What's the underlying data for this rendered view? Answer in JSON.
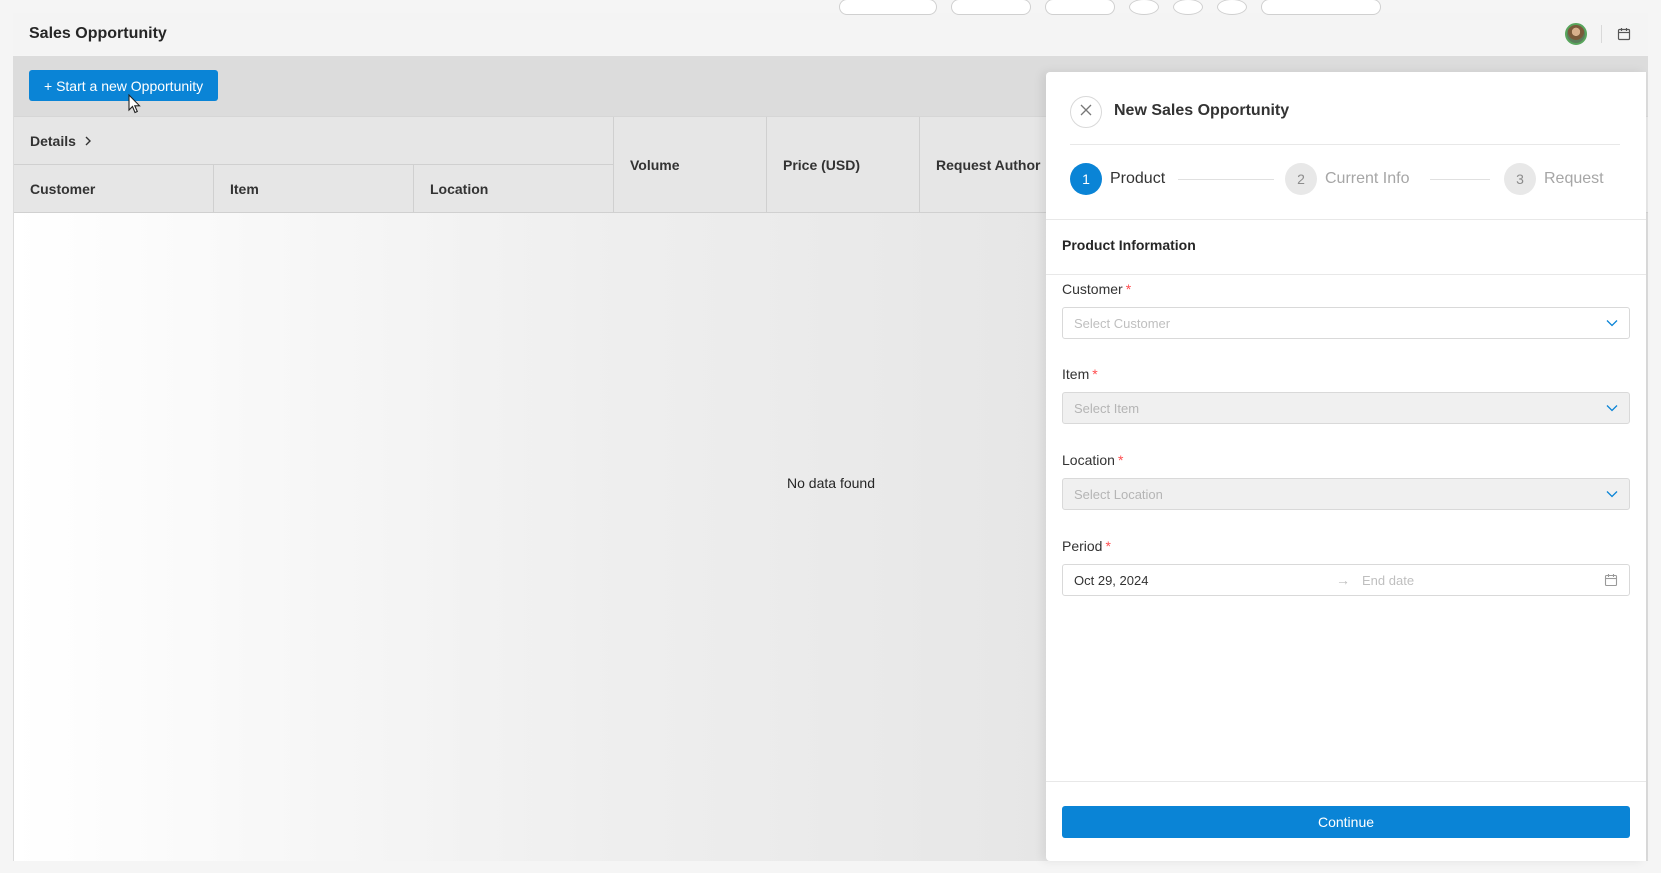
{
  "header": {
    "title": "Sales Opportunity",
    "avatar_icon": "user-avatar",
    "calendar_icon": "calendar-icon"
  },
  "main": {
    "start_button_label": "+ Start a new Opportunity"
  },
  "table": {
    "group_header": "Details",
    "columns": [
      "Customer",
      "Item",
      "Location",
      "Volume",
      "Price (USD)",
      "Request Author"
    ],
    "empty_text": "No data found"
  },
  "drawer": {
    "title": "New Sales Opportunity",
    "steps": [
      {
        "number": "1",
        "label": "Product"
      },
      {
        "number": "2",
        "label": "Current Info"
      },
      {
        "number": "3",
        "label": "Request"
      }
    ],
    "section_title": "Product Information",
    "fields": {
      "customer": {
        "label": "Customer",
        "required": "*",
        "placeholder": "Select Customer"
      },
      "item": {
        "label": "Item",
        "required": "*",
        "placeholder": "Select Item"
      },
      "location": {
        "label": "Location",
        "required": "*",
        "placeholder": "Select Location"
      },
      "period": {
        "label": "Period",
        "required": "*",
        "start": "Oct 29, 2024",
        "end_placeholder": "End date"
      }
    },
    "continue_label": "Continue"
  },
  "colors": {
    "primary": "#0a84d6",
    "required": "#ff4d4f"
  }
}
